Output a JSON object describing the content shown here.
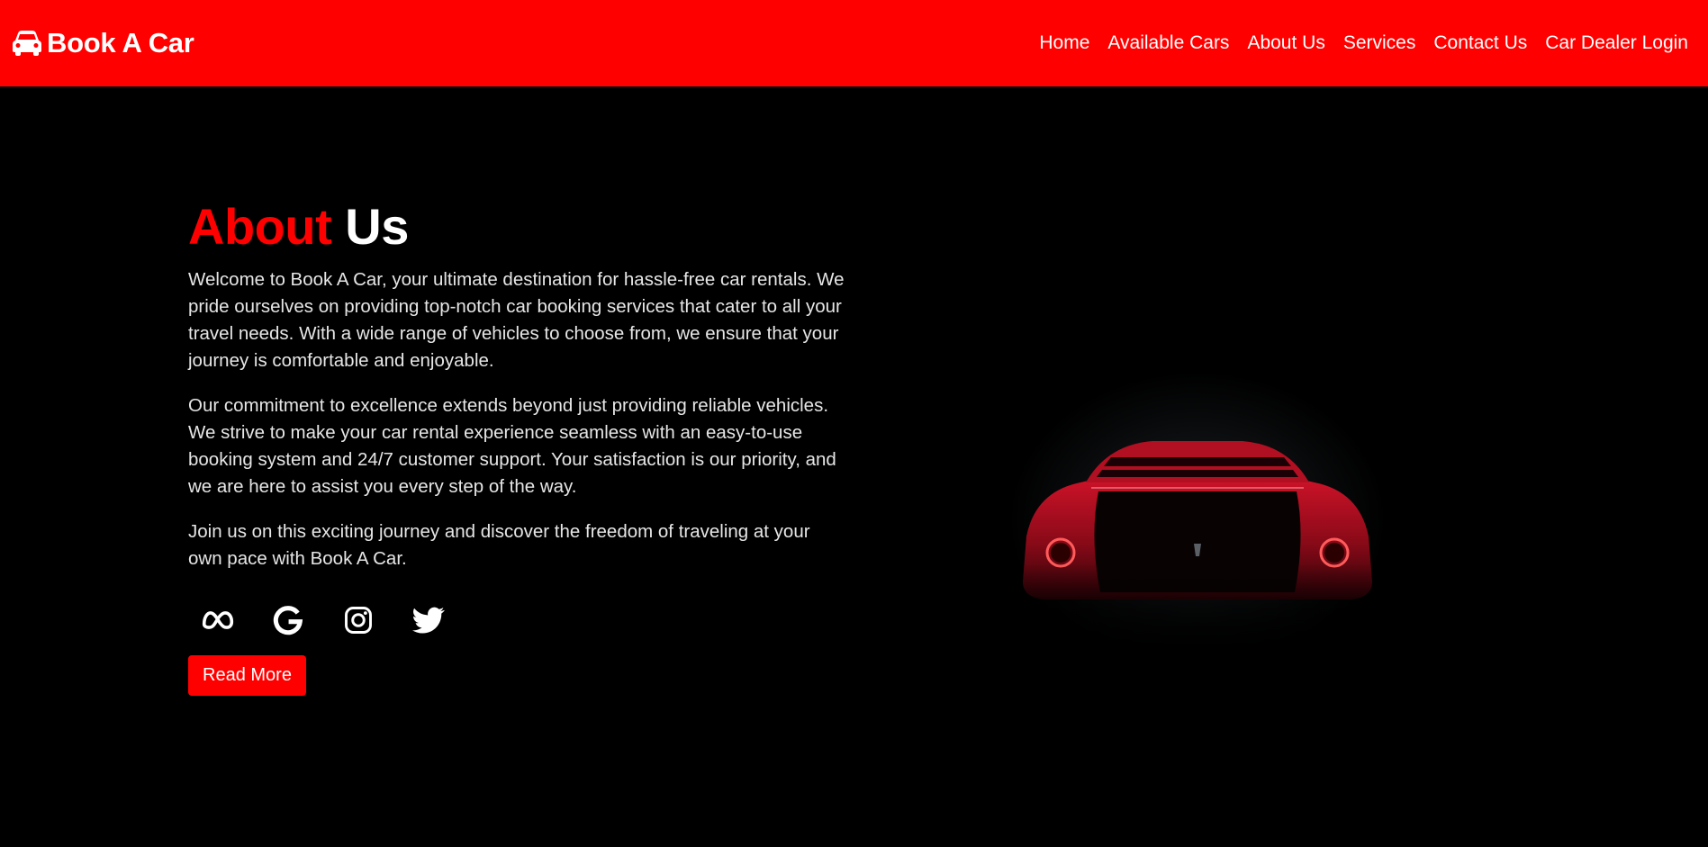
{
  "header": {
    "brand": "Book A Car",
    "brand_icon": "car-icon",
    "nav": [
      {
        "label": "Home"
      },
      {
        "label": "Available Cars"
      },
      {
        "label": "About Us"
      },
      {
        "label": "Services"
      },
      {
        "label": "Contact Us"
      },
      {
        "label": "Car Dealer Login"
      }
    ]
  },
  "about": {
    "title_accent": "About",
    "title_rest": "Us",
    "paragraphs": [
      "Welcome to Book A Car, your ultimate destination for hassle-free car rentals. We pride ourselves on providing top-notch car booking services that cater to all your travel needs. With a wide range of vehicles to choose from, we ensure that your journey is comfortable and enjoyable.",
      "Our commitment to excellence extends beyond just providing reliable vehicles. We strive to make your car rental experience seamless with an easy-to-use booking system and 24/7 customer support. Your satisfaction is our priority, and we are here to assist you every step of the way.",
      "Join us on this exciting journey and discover the freedom of traveling at your own pace with Book A Car."
    ],
    "socials": [
      "meta-icon",
      "google-icon",
      "instagram-icon",
      "twitter-icon"
    ],
    "button_label": "Read More"
  },
  "image": {
    "icon": "red-sports-car-rear-view"
  },
  "colors": {
    "accent": "#ff0000",
    "background": "#000000",
    "text": "#ffffff"
  }
}
